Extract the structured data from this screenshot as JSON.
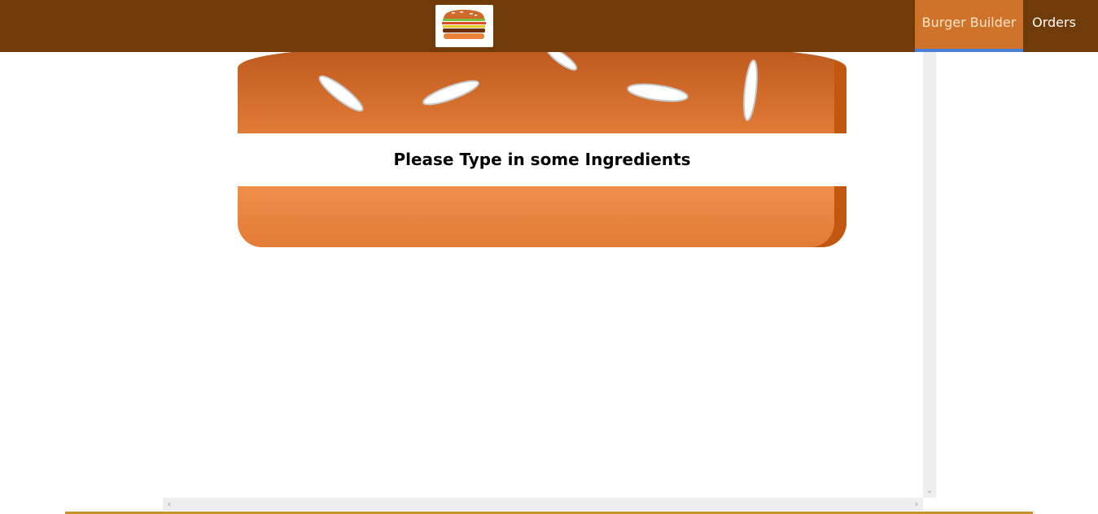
{
  "toolbar": {
    "logo_icon": "burger-logo-icon",
    "nav": [
      {
        "label": "Burger Builder",
        "active": true
      },
      {
        "label": "Orders",
        "active": false
      }
    ]
  },
  "burger": {
    "empty_message": "Please Type in some Ingredients"
  },
  "colors": {
    "toolbar": "#703b09",
    "active_nav": "#d0732a",
    "active_nav_border": "#4a7fd6",
    "bread": "#e27b36",
    "bread_shadow": "#c15711",
    "footer_line": "#c8922a"
  },
  "icons": {
    "scroll_down": "chevron-down-icon",
    "scroll_left": "chevron-left-icon",
    "scroll_right": "chevron-right-icon"
  }
}
